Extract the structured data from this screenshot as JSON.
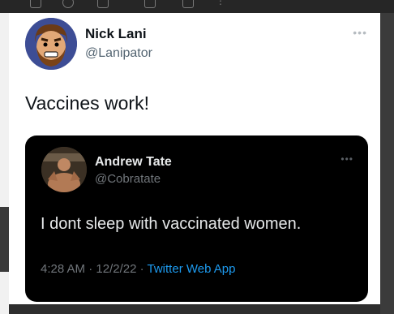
{
  "tweet": {
    "author_name": "Nick Lani",
    "author_handle": "@Lanipator",
    "text": "Vaccines work!",
    "more_icon": "ellipsis-icon"
  },
  "quoted_tweet": {
    "author_name": "Andrew Tate",
    "author_handle": "@Cobratate",
    "text": "I dont sleep with vaccinated women.",
    "time": "4:28 AM",
    "date": "12/2/22",
    "source": "Twitter Web App",
    "more_icon": "ellipsis-icon"
  },
  "colors": {
    "link_blue": "#1d9bf0",
    "avatar_bg": "#3d4d95"
  }
}
